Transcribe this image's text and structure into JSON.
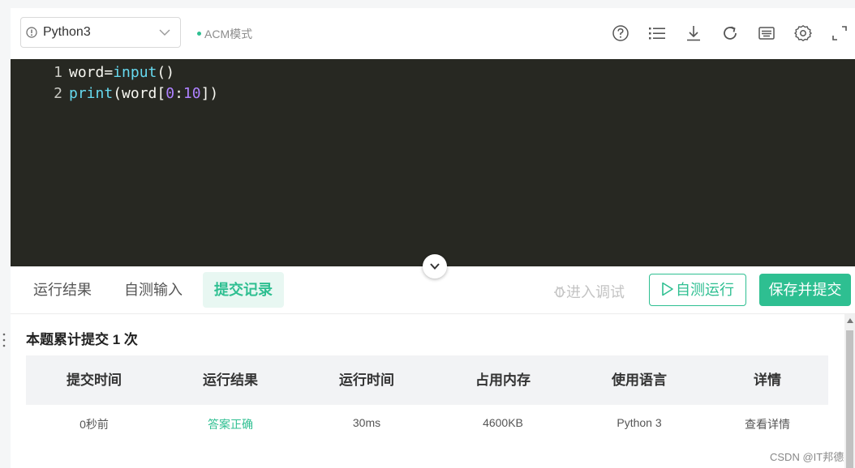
{
  "toolbar": {
    "language": "Python3",
    "mode": "ACM模式",
    "icons": [
      "help-icon",
      "list-icon",
      "download-icon",
      "reload-icon",
      "keyboard-icon",
      "settings-icon",
      "fullscreen-icon"
    ]
  },
  "editor": {
    "lines": [
      {
        "no": "1",
        "tokens": [
          {
            "text": "word=",
            "type": "plain"
          },
          {
            "text": "input",
            "type": "fn"
          },
          {
            "text": "()",
            "type": "plain"
          }
        ]
      },
      {
        "no": "2",
        "tokens": [
          {
            "text": "print",
            "type": "fn"
          },
          {
            "text": "(word[",
            "type": "plain"
          },
          {
            "text": "0",
            "type": "num"
          },
          {
            "text": ":",
            "type": "plain"
          },
          {
            "text": "10",
            "type": "num"
          },
          {
            "text": "])",
            "type": "plain"
          }
        ]
      }
    ]
  },
  "tabs": {
    "run_result": "运行结果",
    "self_test_input": "自测输入",
    "submission_records": "提交记录",
    "active": "submission_records"
  },
  "actions": {
    "debug": "进入调试",
    "self_run": "自测运行",
    "save_submit": "保存并提交"
  },
  "records": {
    "summary": "本题累计提交 1 次",
    "columns": [
      "提交时间",
      "运行结果",
      "运行时间",
      "占用内存",
      "使用语言",
      "详情"
    ],
    "rows": [
      {
        "time": "0秒前",
        "result": "答案正确",
        "runtime": "30ms",
        "memory": "4600KB",
        "language": "Python 3",
        "detail": "查看详情"
      }
    ]
  },
  "watermark": "CSDN @IT邦德",
  "colors": {
    "accent": "#2ebf91",
    "editor_bg": "#272822"
  }
}
